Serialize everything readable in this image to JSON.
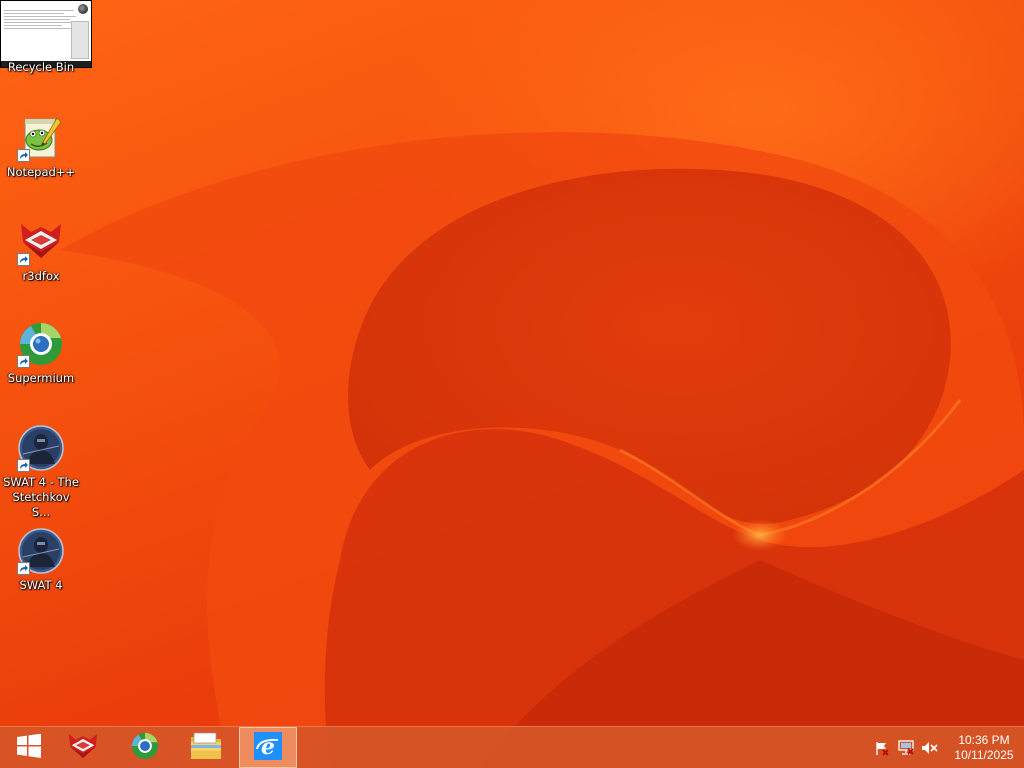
{
  "desktop": {
    "icons": [
      {
        "label": "Notepad++",
        "icon": "notepad-plus-plus-icon"
      },
      {
        "label": "r3dfox",
        "icon": "r3dfox-icon"
      },
      {
        "label": "Supermium",
        "icon": "supermium-icon"
      },
      {
        "label": "SWAT 4 - The Stetchkov S...",
        "icon": "swat4-icon"
      },
      {
        "label": "SWAT 4",
        "icon": "swat4-icon"
      }
    ],
    "hidden_icon_label": "Recycle Bin"
  },
  "taskbar": {
    "pinned": [
      {
        "name": "start",
        "icon": "windows-logo-icon"
      },
      {
        "name": "r3dfox",
        "icon": "r3dfox-icon"
      },
      {
        "name": "supermium",
        "icon": "supermium-icon"
      },
      {
        "name": "file-explorer",
        "icon": "folder-icon"
      },
      {
        "name": "internet-explorer",
        "icon": "internet-explorer-icon",
        "active": true
      }
    ],
    "tray": {
      "icons": [
        "action-center-flag-icon",
        "network-icon",
        "volume-muted-icon"
      ],
      "time": "10:36 PM",
      "date": "10/11/2025"
    }
  },
  "colors": {
    "wallpaper_base": "#e8450f",
    "taskbar": "#d65628",
    "label_text": "#ffffff"
  }
}
